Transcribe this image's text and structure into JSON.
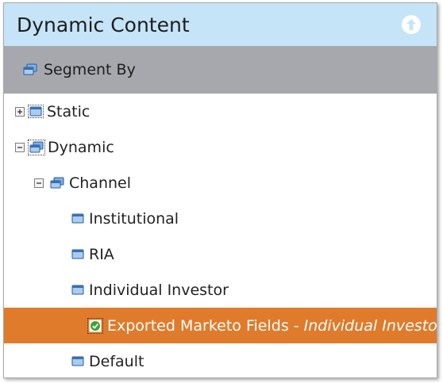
{
  "panel": {
    "title": "Dynamic Content",
    "collapse_icon": "arrow-up-circle-icon"
  },
  "segment_bar": {
    "label": "Segment By",
    "icon": "segment-stack-icon"
  },
  "tree": {
    "static": {
      "label": "Static",
      "expanded": false
    },
    "dynamic": {
      "label": "Dynamic",
      "expanded": true
    },
    "channel": {
      "label": "Channel",
      "expanded": true
    },
    "institutional": {
      "label": "Institutional"
    },
    "ria": {
      "label": "RIA"
    },
    "individual_investor": {
      "label": "Individual Investor"
    },
    "exported": {
      "label": "Exported Marketo Fields",
      "separator": " - ",
      "segment": "Individual Investor",
      "selected": true
    },
    "default": {
      "label": "Default"
    }
  },
  "colors": {
    "header_bg": "#c5e4f8",
    "segment_bar_bg": "#a6a8ad",
    "selected_bg": "#e07b2c",
    "icon_blue": "#3a6fb5"
  }
}
